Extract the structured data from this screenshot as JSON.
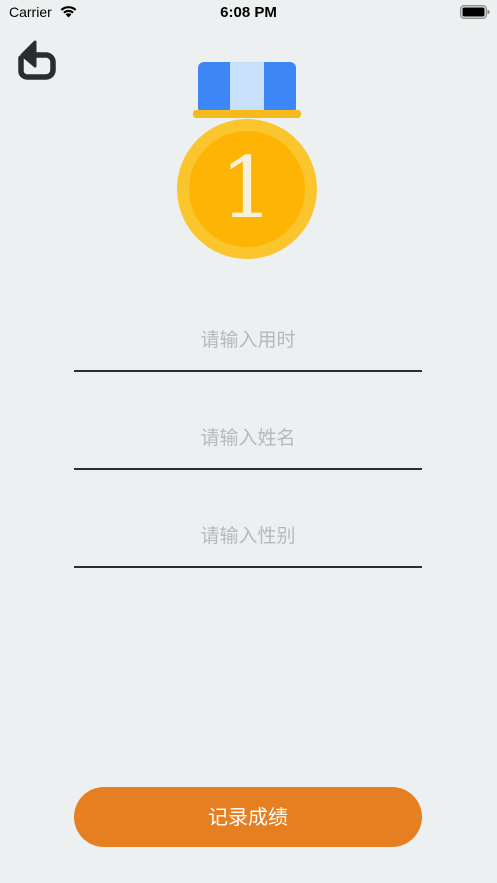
{
  "status_bar": {
    "carrier": "Carrier",
    "time": "6:08 PM",
    "wifi_icon": "wifi-icon",
    "battery_icon": "battery-icon"
  },
  "header": {
    "back_icon": "undo-arrow-icon"
  },
  "medal": {
    "icon": "gold-medal-icon",
    "rank": "1",
    "ribbon_color": "#3d86f5",
    "ribbon_stripe_color": "#c9e0fb",
    "outer_color": "#fbc52e",
    "inner_color": "#feb405"
  },
  "form": {
    "time_placeholder": "请输入用时",
    "name_placeholder": "请输入姓名",
    "gender_placeholder": "请输入性别"
  },
  "submit": {
    "label": "记录成绩",
    "color": "#e67f22"
  }
}
